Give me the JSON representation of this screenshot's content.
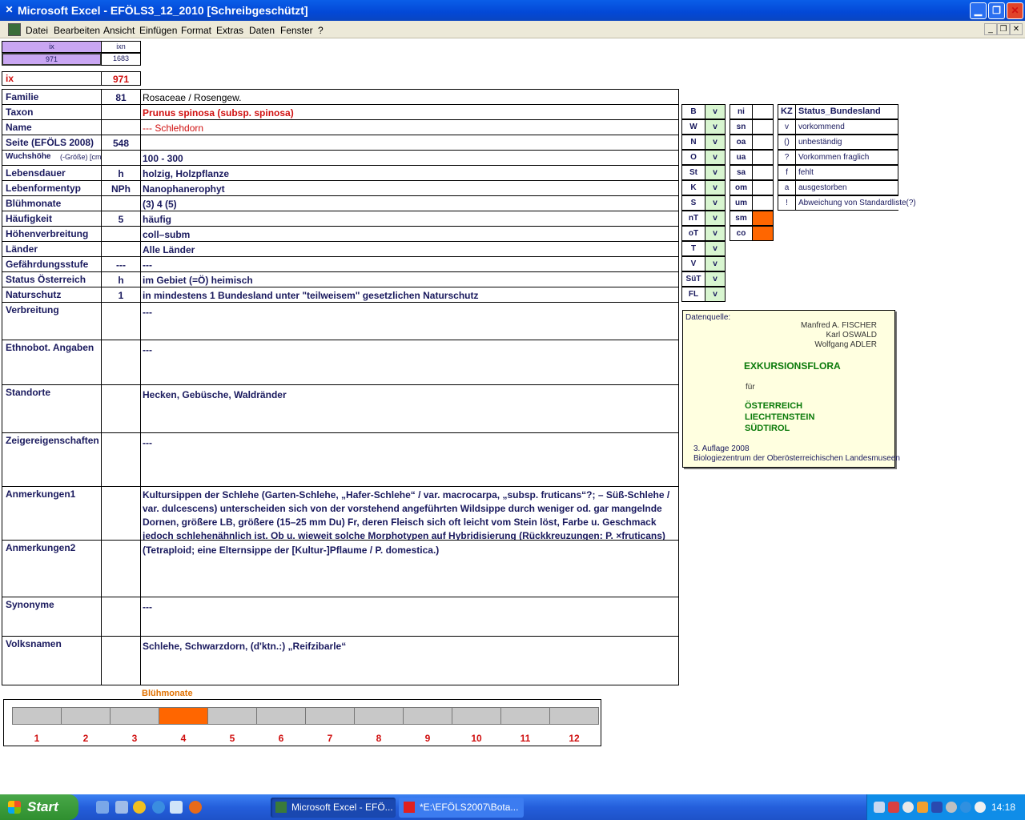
{
  "window": {
    "title": "Microsoft Excel - EFÖLS3_12_2010  [Schreibgeschützt]"
  },
  "menu": [
    "Datei",
    "Bearbeiten",
    "Ansicht",
    "Einfügen",
    "Format",
    "Extras",
    "Daten",
    "Fenster",
    "?"
  ],
  "topgrid": {
    "h1": "ix",
    "h2": "ixn",
    "v1": "971",
    "v2": "1683",
    "ix_label": "ix",
    "ix_value": "971"
  },
  "rows": [
    {
      "label": "Familie",
      "code": "81",
      "text": "Rosaceae  /  Rosengew."
    },
    {
      "label": "Taxon",
      "code": "",
      "text": "Prunus spinosa (subsp. spinosa)"
    },
    {
      "label": "Name",
      "code": "",
      "text": "--- Schlehdorn"
    },
    {
      "label": "Seite (EFÖLS 2008)",
      "code": "548",
      "text": ""
    },
    {
      "label": "Wuchshöhe",
      "label_small": " (-Größe) [cm]",
      "code": "",
      "text": "100 - 300"
    },
    {
      "label": "Lebensdauer",
      "code": "h",
      "text": "holzig, Holzpflanze"
    },
    {
      "label": "Lebenformentyp",
      "code": "NPh",
      "text": "Nanophanerophyt"
    },
    {
      "label": "Blühmonate",
      "code": "",
      "text": "(3) 4 (5)"
    },
    {
      "label": "Häufigkeit",
      "code": "5",
      "text": "häufig"
    },
    {
      "label": "Höhenverbreitung",
      "code": "",
      "text": "coll–subm"
    },
    {
      "label": "Länder",
      "code": "",
      "text": "Alle Länder"
    },
    {
      "label": "Gefährdungsstufe",
      "code": "---",
      "text": "---"
    },
    {
      "label": "Status Österreich",
      "code": "h",
      "text": "im Gebiet (=Ö) heimisch"
    },
    {
      "label": "Naturschutz",
      "code": "1",
      "text": "in mindestens 1 Bundesland unter \"teilweisem\" gesetzlichen Naturschutz"
    },
    {
      "label": "Verbreitung",
      "code": "",
      "text": "---"
    },
    {
      "label": "Ethnobot. Angaben",
      "code": "",
      "text": "---"
    },
    {
      "label": "Standorte",
      "code": "",
      "text": "Hecken, Gebüsche, Waldränder"
    },
    {
      "label": "Zeigereigenschaften",
      "code": "",
      "text": "---"
    },
    {
      "label": "Anmerkungen1",
      "code": "",
      "text": "Kultursippen der Schlehe (Garten-Schlehe, „Hafer-Schlehe“ / var. macrocarpa, „subsp. fruticans“?; – Süß-Schlehe / var. dulcescens) unterscheiden sich von der vorstehend angeführten Wildsippe durch weniger od. gar mangelnde Dornen, größere LB, größere (15–25 mm Du) Fr, deren Fleisch sich oft leicht vom Stein löst, Farbe u. Geschmack jedoch schlehenähnlich ist. Ob u. wieweit solche Morphotypen auf Hybridisierung (Rückkreuzungen: P. ×fruticans) mit"
    },
    {
      "label": "Anmerkungen2",
      "code": "",
      "text": "(Tetraploid; eine Elternsippe der [Kultur-]Pflaume / P. domestica.)"
    },
    {
      "label": "Synonyme",
      "code": "",
      "text": "---"
    },
    {
      "label": "Volksnamen",
      "code": "",
      "text": "Schlehe,   Schwarzdorn, (d'ktn.:) „Reifzibarle“"
    }
  ],
  "bundeslaender": [
    {
      "k": "B",
      "v": "v"
    },
    {
      "k": "W",
      "v": "v"
    },
    {
      "k": "N",
      "v": "v"
    },
    {
      "k": "O",
      "v": "v"
    },
    {
      "k": "St",
      "v": "v"
    },
    {
      "k": "K",
      "v": "v"
    },
    {
      "k": "S",
      "v": "v"
    },
    {
      "k": "nT",
      "v": "v"
    },
    {
      "k": "oT",
      "v": "v"
    },
    {
      "k": "T",
      "v": "v"
    },
    {
      "k": "V",
      "v": "v"
    },
    {
      "k": "SüT",
      "v": "v"
    },
    {
      "k": "FL",
      "v": "v"
    }
  ],
  "hoehen": [
    {
      "k": "ni",
      "on": false
    },
    {
      "k": "sn",
      "on": false
    },
    {
      "k": "oa",
      "on": false
    },
    {
      "k": "ua",
      "on": false
    },
    {
      "k": "sa",
      "on": false
    },
    {
      "k": "om",
      "on": false
    },
    {
      "k": "um",
      "on": false
    },
    {
      "k": "sm",
      "on": true
    },
    {
      "k": "co",
      "on": true
    }
  ],
  "kz": {
    "header_kz": "KZ",
    "header_status": "Status_Bundesland",
    "items": [
      {
        "k": "v",
        "t": "vorkommend"
      },
      {
        "k": "()",
        "t": "unbeständig"
      },
      {
        "k": "?",
        "t": "Vorkommen fraglich"
      },
      {
        "k": "f",
        "t": "fehlt"
      },
      {
        "k": "a",
        "t": "ausgestorben"
      },
      {
        "k": "!",
        "t": "Abweichung von Standardliste(?)"
      }
    ]
  },
  "datenquelle": {
    "label": "Datenquelle:",
    "authors": [
      "Manfred A. FISCHER",
      "Karl OSWALD",
      "Wolfgang ADLER"
    ],
    "title": "EXKURSIONSFLORA",
    "fuer": "für",
    "countries": [
      "ÖSTERREICH",
      "LIECHTENSTEIN",
      "SÜDTIROL"
    ],
    "edition": "3. Auflage 2008",
    "publisher": "Biologiezentrum der Oberösterreichischen Landesmuseen"
  },
  "bluehmonate": {
    "title": "Blühmonate",
    "months": [
      "1",
      "2",
      "3",
      "4",
      "5",
      "6",
      "7",
      "8",
      "9",
      "10",
      "11",
      "12"
    ],
    "active": [
      4
    ]
  },
  "colors": {
    "active": "#ff6600",
    "green": "#d8f5d0",
    "label": "#1a1a5e",
    "red": "#d01010"
  },
  "taskbar": {
    "start": "Start",
    "tasks": [
      "Microsoft Excel - EFÖ...",
      "*E:\\EFÖLS2007\\Bota..."
    ],
    "clock": "14:18"
  }
}
